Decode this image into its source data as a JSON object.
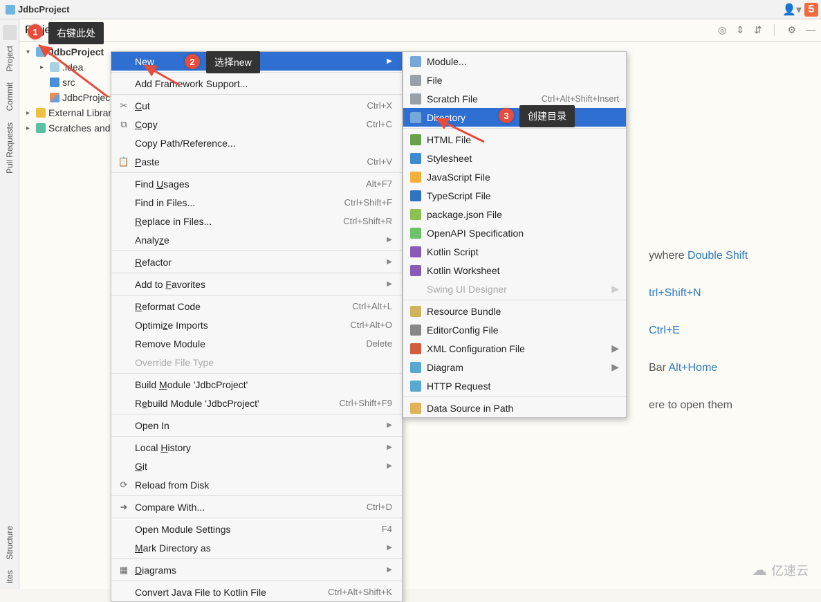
{
  "breadcrumb": {
    "project_name": "JdbcProject"
  },
  "left_rail": {
    "tabs": [
      "Project",
      "Commit",
      "Pull Requests"
    ],
    "bottom_tabs": [
      "Structure",
      "ites"
    ]
  },
  "toolwindow": {
    "title": "Project"
  },
  "tree": {
    "root": "JdbcProject",
    "idea": ".idea",
    "src": "src",
    "iml": "JdbcProject",
    "libs": "External Libraries",
    "scratches": "Scratches and"
  },
  "annotations": {
    "tip1": "右键此处",
    "tip2": "选择new",
    "tip3": "创建目录",
    "badge1": "1",
    "badge2": "2",
    "badge3": "3"
  },
  "context_menu": [
    {
      "label": "New",
      "icon": "",
      "submenu": true,
      "highlight": true
    },
    {
      "sep": true
    },
    {
      "label": "Add Framework Support...",
      "icon": ""
    },
    {
      "sep": true
    },
    {
      "label": "Cut",
      "icon": "✂",
      "shortcut": "Ctrl+X",
      "underline": "C"
    },
    {
      "label": "Copy",
      "icon": "⧉",
      "shortcut": "Ctrl+C",
      "underline": "C"
    },
    {
      "label": "Copy Path/Reference..."
    },
    {
      "label": "Paste",
      "icon": "📋",
      "shortcut": "Ctrl+V",
      "underline": "P"
    },
    {
      "sep": true
    },
    {
      "label": "Find Usages",
      "shortcut": "Alt+F7",
      "underline": "U"
    },
    {
      "label": "Find in Files...",
      "shortcut": "Ctrl+Shift+F"
    },
    {
      "label": "Replace in Files...",
      "shortcut": "Ctrl+Shift+R",
      "underline": "R"
    },
    {
      "label": "Analyze",
      "submenu": true,
      "underline": "z"
    },
    {
      "sep": true
    },
    {
      "label": "Refactor",
      "submenu": true,
      "underline": "R"
    },
    {
      "sep": true
    },
    {
      "label": "Add to Favorites",
      "submenu": true,
      "underline": "F"
    },
    {
      "sep": true
    },
    {
      "label": "Reformat Code",
      "shortcut": "Ctrl+Alt+L",
      "underline": "R"
    },
    {
      "label": "Optimize Imports",
      "shortcut": "Ctrl+Alt+O",
      "underline": "z"
    },
    {
      "label": "Remove Module",
      "shortcut": "Delete"
    },
    {
      "label": "Override File Type",
      "disabled": true
    },
    {
      "sep": true
    },
    {
      "label": "Build Module 'JdbcProject'",
      "underline": "M"
    },
    {
      "label": "Rebuild Module 'JdbcProject'",
      "shortcut": "Ctrl+Shift+F9",
      "underline": "e"
    },
    {
      "sep": true
    },
    {
      "label": "Open In",
      "submenu": true
    },
    {
      "sep": true
    },
    {
      "label": "Local History",
      "submenu": true,
      "underline": "H"
    },
    {
      "label": "Git",
      "submenu": true,
      "underline": "G"
    },
    {
      "label": "Reload from Disk",
      "icon": "⟳"
    },
    {
      "sep": true
    },
    {
      "label": "Compare With...",
      "icon": "➜",
      "shortcut": "Ctrl+D"
    },
    {
      "sep": true
    },
    {
      "label": "Open Module Settings",
      "shortcut": "F4"
    },
    {
      "label": "Mark Directory as",
      "submenu": true,
      "underline": "M"
    },
    {
      "sep": true
    },
    {
      "label": "Diagrams",
      "icon": "▦",
      "submenu": true,
      "underline": "D"
    },
    {
      "sep": true
    },
    {
      "label": "Convert Java File to Kotlin File",
      "shortcut": "Ctrl+Alt+Shift+K"
    }
  ],
  "new_submenu": [
    {
      "label": "Module...",
      "ic": "#76a7db"
    },
    {
      "label": "File",
      "ic": "#9aa0a6"
    },
    {
      "label": "Scratch File",
      "ic": "#9aa0a6",
      "shortcut": "Ctrl+Alt+Shift+Insert"
    },
    {
      "label": "Directory",
      "ic": "#76a7db",
      "highlight": true
    },
    {
      "sep": true
    },
    {
      "label": "HTML File",
      "ic": "#67a14b"
    },
    {
      "label": "Stylesheet",
      "ic": "#3c8bd1"
    },
    {
      "label": "JavaScript File",
      "ic": "#f2b13a"
    },
    {
      "label": "TypeScript File",
      "ic": "#3273c0"
    },
    {
      "label": "package.json File",
      "ic": "#8cc152"
    },
    {
      "label": "OpenAPI Specification",
      "ic": "#6ec26a"
    },
    {
      "label": "Kotlin Script",
      "ic": "#8a5bb6"
    },
    {
      "label": "Kotlin Worksheet",
      "ic": "#8a5bb6"
    },
    {
      "label": "Swing UI Designer",
      "disabled": true,
      "submenu": true
    },
    {
      "sep": true
    },
    {
      "label": "Resource Bundle",
      "ic": "#d0b35c"
    },
    {
      "label": "EditorConfig File",
      "ic": "#888"
    },
    {
      "label": "XML Configuration File",
      "ic": "#d15c3f",
      "submenu": true
    },
    {
      "label": "Diagram",
      "ic": "#5aa7cf",
      "submenu": true
    },
    {
      "label": "HTTP Request",
      "ic": "#5aa7cf"
    },
    {
      "sep": true
    },
    {
      "label": "Data Source in Path",
      "ic": "#e0b35a"
    }
  ],
  "hints": {
    "l1a": "ywhere ",
    "l1b": "Double Shift",
    "l2b": "trl+Shift+N",
    "l3b": "Ctrl+E",
    "l4a": "Bar ",
    "l4b": "Alt+Home",
    "l5": "ere to open them"
  },
  "watermark": "亿速云"
}
